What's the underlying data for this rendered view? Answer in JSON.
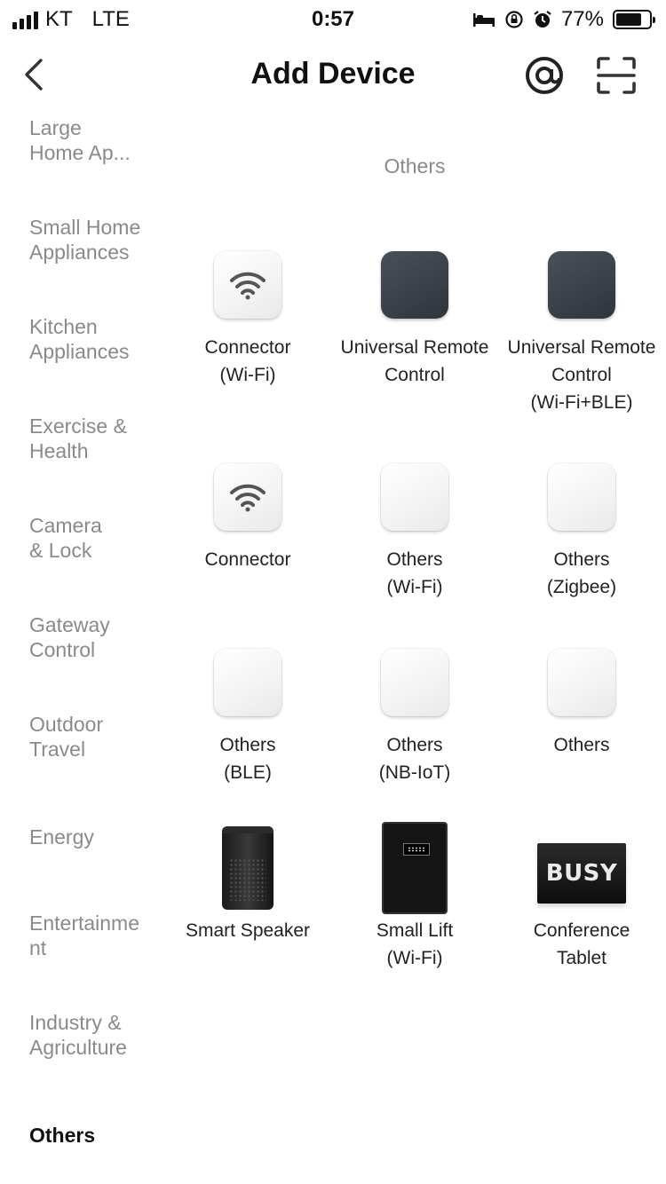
{
  "status_bar": {
    "carrier": "KT",
    "network": "LTE",
    "time": "0:57",
    "battery_percent": "77%",
    "battery_level": 0.77
  },
  "nav": {
    "title": "Add Device",
    "icons": [
      "back-chevron-icon",
      "at-sign-icon",
      "scan-icon"
    ]
  },
  "sidebar": {
    "items": [
      {
        "label": "Large\nHome Ap...",
        "active": false
      },
      {
        "label": "Small Home Appliances",
        "active": false
      },
      {
        "label": "Kitchen Appliances",
        "active": false
      },
      {
        "label": "Exercise & Health",
        "active": false
      },
      {
        "label": "Camera & Lock",
        "active": false
      },
      {
        "label": "Gateway Control",
        "active": false
      },
      {
        "label": "Outdoor Travel",
        "active": false
      },
      {
        "label": "Energy",
        "active": false
      },
      {
        "label": "Entertainment",
        "active": false
      },
      {
        "label": "Industry & Agriculture",
        "active": false
      },
      {
        "label": "Others",
        "active": true
      }
    ]
  },
  "section": {
    "title": "Others"
  },
  "devices": [
    {
      "line1": "Connector",
      "line2": "(Wi-Fi)",
      "line3": "",
      "icon": "wifi-tile-icon"
    },
    {
      "line1": "Universal Remote",
      "line2": "Control",
      "line3": "",
      "icon": "dark-tile-icon"
    },
    {
      "line1": "Universal Remote",
      "line2": "Control",
      "line3": "(Wi-Fi+BLE)",
      "icon": "dark-tile-icon"
    },
    {
      "line1": "Connector",
      "line2": "",
      "line3": "",
      "icon": "wifi-tile-icon"
    },
    {
      "line1": "Others",
      "line2": "(Wi-Fi)",
      "line3": "",
      "icon": "blank-tile-icon"
    },
    {
      "line1": "Others",
      "line2": "(Zigbee)",
      "line3": "",
      "icon": "blank-tile-icon"
    },
    {
      "line1": "Others",
      "line2": "(BLE)",
      "line3": "",
      "icon": "blank-tile-icon"
    },
    {
      "line1": "Others",
      "line2": "(NB-IoT)",
      "line3": "",
      "icon": "blank-tile-icon"
    },
    {
      "line1": "Others",
      "line2": "",
      "line3": "",
      "icon": "blank-tile-icon"
    },
    {
      "line1": "Smart Speaker",
      "line2": "",
      "line3": "",
      "icon": "smart-speaker-icon"
    },
    {
      "line1": "Small Lift",
      "line2": "(Wi-Fi)",
      "line3": "",
      "icon": "safe-box-icon"
    },
    {
      "line1": "Conference",
      "line2": "Tablet",
      "line3": "",
      "icon": "busy-sign-icon",
      "badge_text": "BUSY"
    }
  ]
}
